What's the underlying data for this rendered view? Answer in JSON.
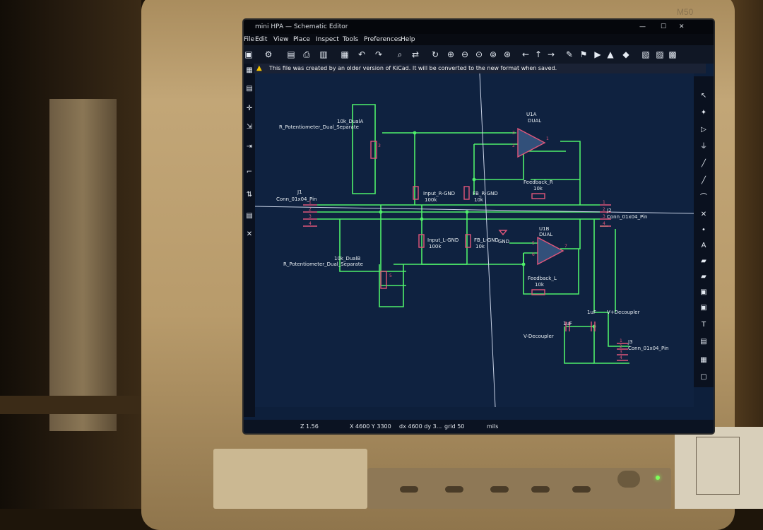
{
  "monitor": {
    "label": "M50"
  },
  "window": {
    "title": "mini HPA — Schematic Editor",
    "controls": [
      "—",
      "☐",
      "✕"
    ]
  },
  "menu": [
    "File",
    "Edit",
    "View",
    "Place",
    "Inspect",
    "Tools",
    "Preferences",
    "Help"
  ],
  "infobar": {
    "message": "This file was created by an older version of KiCad. It will be converted to the new format when saved."
  },
  "schematic": {
    "components": {
      "pot_a_value": "10k_DualA",
      "pot_a_name": "R_Potentiometer_Dual_Separate",
      "pot_b_value": "10k_DualB",
      "pot_b_name": "R_Potentiometer_Dual_Separate",
      "j1_ref": "J1",
      "j1_name": "Conn_01x04_Pin",
      "j2_ref": "J2",
      "j2_name": "Conn_01x04_Pin",
      "j3_ref": "J3",
      "j3_name": "Conn_01x04_Pin",
      "u1a_ref": "U1A",
      "u1a_type": "DUAL",
      "u1b_ref": "U1B",
      "u1b_type": "DUAL",
      "input_r": "Input_R-GND",
      "input_r_val": "100k",
      "fb_r": "FB_R-GND",
      "fb_r_val": "10k",
      "input_l": "Input_L-GND",
      "input_l_val": "100k",
      "fb_l": "FB_L-GND",
      "fb_l_val": "10k",
      "feedback_r": "Feedback_R",
      "feedback_r_val": "10k",
      "feedback_l": "Feedback_L",
      "feedback_l_val": "10k",
      "gnd": "GND",
      "vplus_decoupler": "V+Decoupler",
      "vminus_decoupler": "V-Decoupler",
      "cap_val_1": "1uF",
      "cap_val_2": "1uF"
    },
    "pins": {
      "j1": [
        "1",
        "2",
        "3",
        "4"
      ],
      "j2": [
        "1",
        "2",
        "3",
        "4"
      ],
      "j3": [
        "1",
        "2",
        "3",
        "4"
      ],
      "u1a": [
        "3",
        "2",
        "1"
      ],
      "u1b": [
        "5",
        "6",
        "7"
      ],
      "pot_a": "3",
      "pot_b": "5"
    }
  },
  "status": {
    "zoom": "Z 1.56",
    "coords": "X 4600  Y 3300",
    "delta": "dx 4600  dy 3...",
    "grid": "grid 50",
    "units": "mils"
  },
  "colors": {
    "wire": "#4ff06a",
    "symbol": "#e0567a",
    "text": "#e8eef2",
    "background": "#0f2240"
  }
}
